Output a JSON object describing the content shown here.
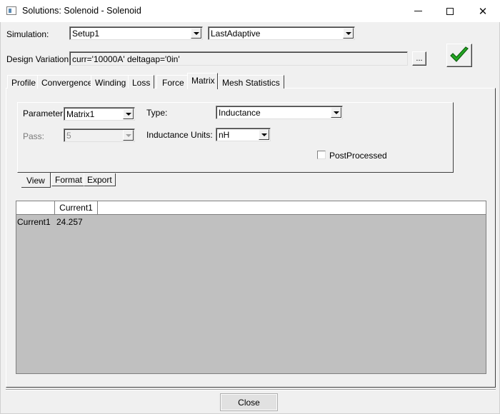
{
  "window": {
    "title": "Solutions: Solenoid - Solenoid",
    "minimize_icon": "minimize-icon",
    "maximize_icon": "maximize-icon",
    "close_glyph": "✕"
  },
  "simulation": {
    "label": "Simulation:",
    "setup_value": "Setup1",
    "solution_value": "LastAdaptive"
  },
  "design_variation": {
    "label": "Design Variation:",
    "value": "curr='10000A' deltagap='0in'",
    "browse_label": "..."
  },
  "accept_icon": "checkmark-icon",
  "tabs": [
    {
      "label": "Profile",
      "active": false
    },
    {
      "label": "Convergence",
      "active": false
    },
    {
      "label": "Winding",
      "active": false
    },
    {
      "label": "Loss",
      "active": false
    },
    {
      "label": "Force",
      "active": false
    },
    {
      "label": "Matrix",
      "active": true
    },
    {
      "label": "Mesh Statistics",
      "active": false
    }
  ],
  "matrix": {
    "parameter_label": "Parameter:",
    "parameter_value": "Matrix1",
    "type_label": "Type:",
    "type_value": "Inductance",
    "pass_label": "Pass:",
    "pass_value": "5",
    "units_label": "Inductance Units:",
    "units_value": "nH",
    "postprocessed_label": "PostProcessed",
    "postprocessed_checked": false
  },
  "subtabs": [
    {
      "label": "View",
      "active": true
    },
    {
      "label": "Format",
      "active": false
    },
    {
      "label": "Export",
      "active": false
    }
  ],
  "grid": {
    "columns": [
      "",
      "Current1"
    ],
    "rows": [
      {
        "label": "Current1",
        "values": [
          "24.257"
        ]
      }
    ]
  },
  "footer": {
    "close_label": "Close"
  },
  "colors": {
    "accept_check": "#22a822",
    "grid_background": "#c0c0c0"
  }
}
